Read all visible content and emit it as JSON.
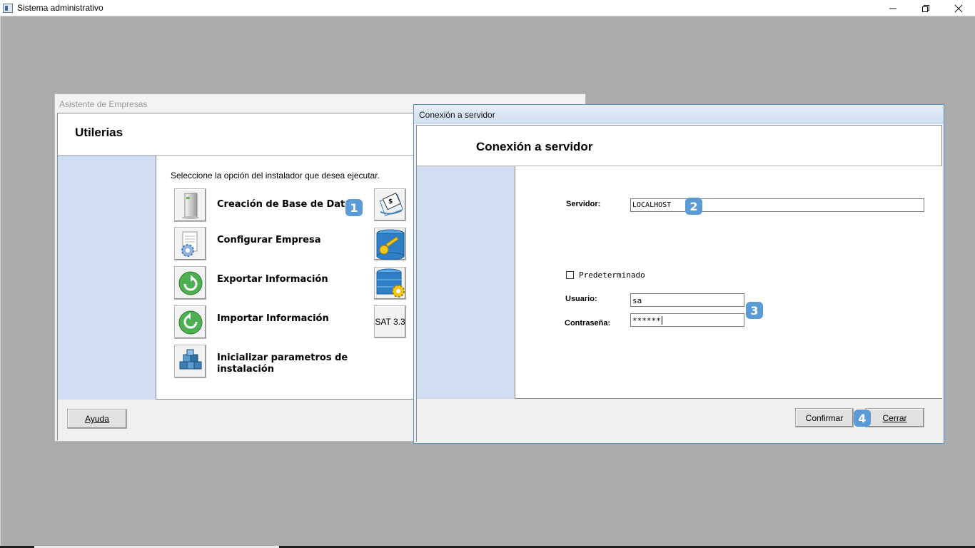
{
  "window": {
    "title": "Sistema administrativo",
    "controls": [
      "minimize",
      "restore",
      "close"
    ]
  },
  "assistant_dialog": {
    "title": "Asistente de Empresas",
    "heading": "Utilerias",
    "instruction": "Seleccione la opción del instalador que desea ejecutar.",
    "options": [
      {
        "label": "Creación de Base de Datos",
        "icon": "server-icon"
      },
      {
        "label": "Configurar Empresa",
        "icon": "document-gear-icon"
      },
      {
        "label": "Exportar Información",
        "icon": "green-arrow-export-icon"
      },
      {
        "label": "Importar Información",
        "icon": "green-arrow-import-icon"
      },
      {
        "label": "Inicializar parametros de instalación",
        "icon": "blocks-icon"
      }
    ],
    "side_buttons": [
      {
        "icon": "money-document-icon"
      },
      {
        "icon": "database-key-icon"
      },
      {
        "icon": "database-gear-icon"
      },
      {
        "label": "SAT 3.3"
      }
    ],
    "help_button": "Ayuda"
  },
  "connection_dialog": {
    "title": "Conexión a servidor",
    "heading": "Conexión a servidor",
    "server_label": "Servidor:",
    "server_value": "LOCALHOST",
    "default_label": "Predeterminado",
    "default_checked": false,
    "user_label": "Usuario:",
    "user_value": "sa",
    "password_label": "Contraseña:",
    "password_value": "******",
    "confirm_button": "Confirmar",
    "close_button": "Cerrar"
  },
  "annotations": {
    "badge_1": "1",
    "badge_2": "2",
    "badge_3": "3",
    "badge_4": "4"
  },
  "colors": {
    "badge": "#5a9bd5",
    "side_panel": "#cfdcf2",
    "desktop": "#ababab"
  }
}
